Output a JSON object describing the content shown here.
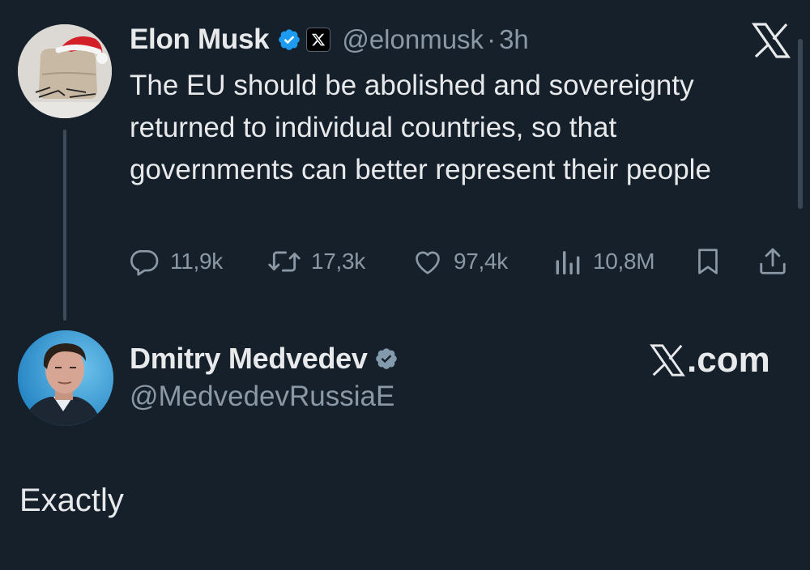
{
  "colors": {
    "background": "#15202b",
    "text": "#e7e9ea",
    "muted": "#8b98a5",
    "verified": "#1d9bf0",
    "verified_gray": "#829aab"
  },
  "original_tweet": {
    "author_name": "Elon Musk",
    "handle": "@elonmusk",
    "separator": "·",
    "time": "3h",
    "badges": [
      "verified-icon",
      "x-affiliate-icon"
    ],
    "text": "The EU should be abolished and sovereignty returned to individual countries, so that governments can better represent their people",
    "stats": {
      "replies": "11,9k",
      "retweets": "17,3k",
      "likes": "97,4k",
      "views": "10,8M"
    }
  },
  "reply_tweet": {
    "author_name": "Dmitry Medvedev",
    "handle": "@MedvedevRussiaE",
    "badges": [
      "verified-gray-icon"
    ],
    "text": "Exactly"
  },
  "watermark": {
    "top_logo": "x-logo-icon",
    "site_label": ".com"
  }
}
